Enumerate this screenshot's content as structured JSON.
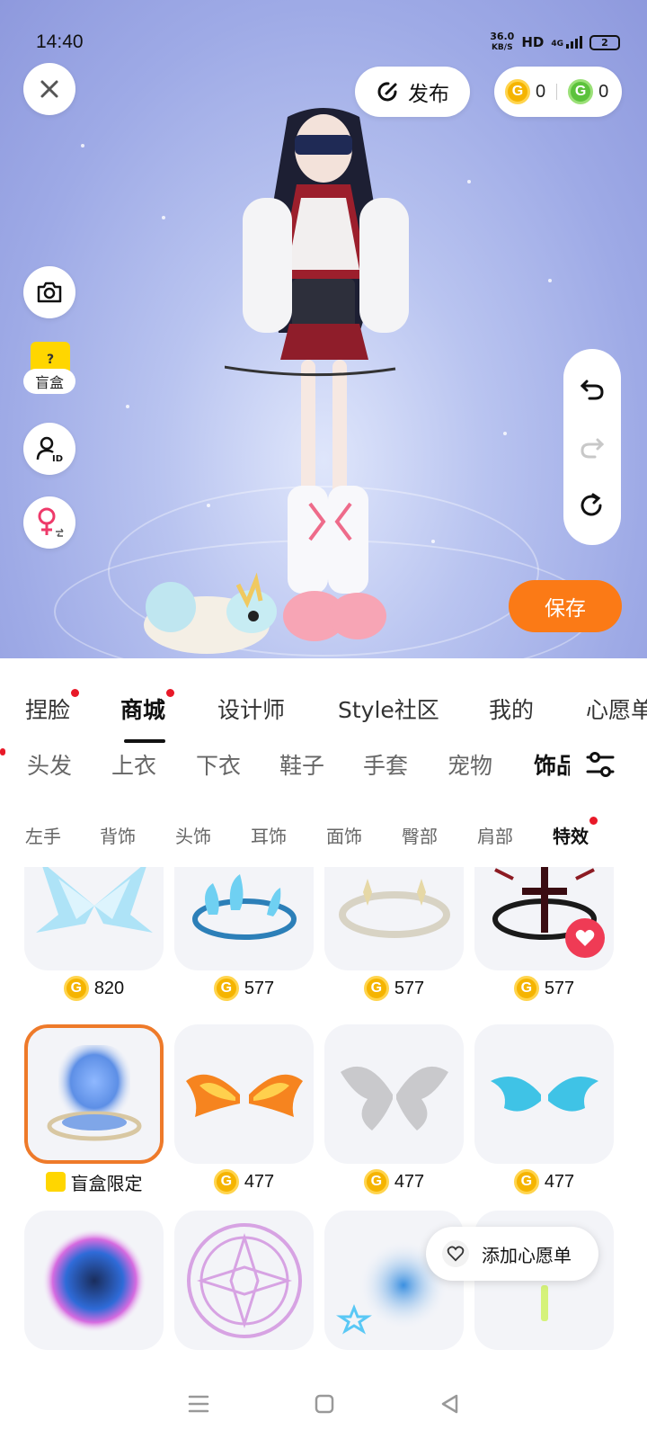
{
  "status_bar": {
    "time": "14:40",
    "speed_value": "36.0",
    "speed_unit": "KB/S",
    "hd": "HD",
    "network": "4G",
    "battery": "2"
  },
  "top_bar": {
    "publish_label": "发布",
    "gold_coins": "0",
    "green_coins": "0"
  },
  "left_tools": {
    "blind_box_label": "盲盒"
  },
  "save_label": "保存",
  "main_tabs": [
    {
      "label": "捏脸",
      "dot": true
    },
    {
      "label": "商城",
      "dot": true,
      "active": true
    },
    {
      "label": "设计师"
    },
    {
      "label": "Style社区"
    },
    {
      "label": "我的"
    },
    {
      "label": "心愿单"
    }
  ],
  "category_tabs": [
    "头发",
    "上衣",
    "下衣",
    "鞋子",
    "手套",
    "宠物",
    "饰品"
  ],
  "sub_tabs": [
    "左手",
    "背饰",
    "头饰",
    "耳饰",
    "面饰",
    "臀部",
    "肩部",
    "特效"
  ],
  "items": [
    {
      "name": "ice-wings",
      "price": "820"
    },
    {
      "name": "blue-flame-circle",
      "price": "577"
    },
    {
      "name": "white-star-circle",
      "price": "577"
    },
    {
      "name": "dark-cross-circle",
      "price": "577",
      "favorited": true
    },
    {
      "name": "blue-portal",
      "price": "盲盒限定",
      "blind_box": true,
      "selected": true
    },
    {
      "name": "fire-wings",
      "price": "477"
    },
    {
      "name": "grey-butterfly-wings",
      "price": "477"
    },
    {
      "name": "cyan-wings",
      "price": "477"
    },
    {
      "name": "rainbow-orb",
      "price": ""
    },
    {
      "name": "pink-magic-circle",
      "price": ""
    },
    {
      "name": "star-glow",
      "price": ""
    },
    {
      "name": "green-sparkle",
      "price": ""
    }
  ],
  "wishlist_popup": {
    "label": "添加心愿单"
  },
  "colors": {
    "accent_orange": "#fb7a16",
    "dot_red": "#e81928",
    "gold_coin": "#f5b400",
    "green_coin": "#5cc23c"
  }
}
